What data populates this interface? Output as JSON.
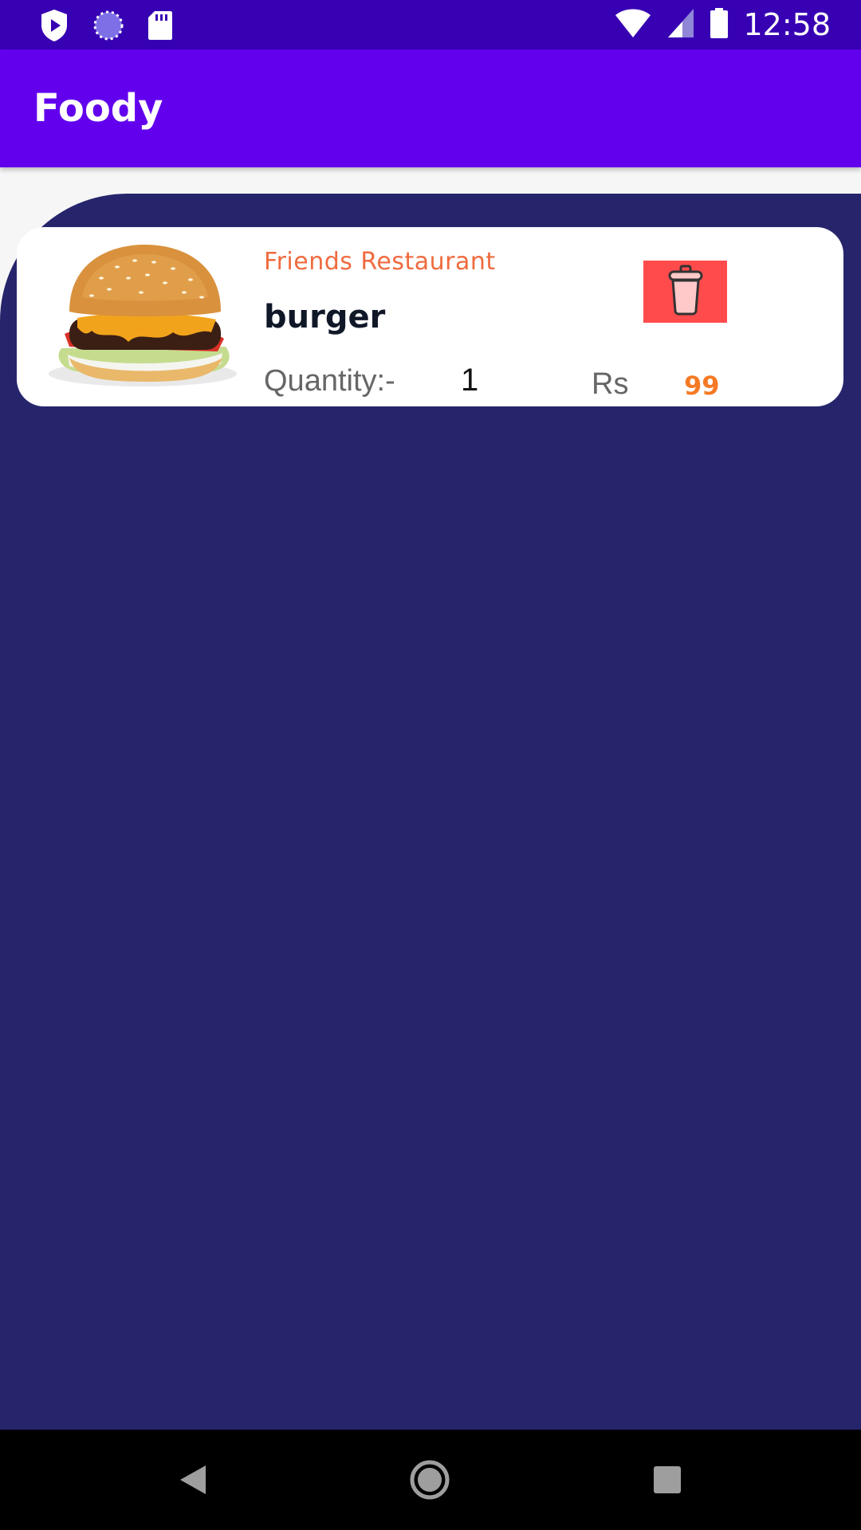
{
  "status_bar": {
    "time": "12:58",
    "icons": [
      "play-protect-icon",
      "sync-progress-icon",
      "sd-card-icon",
      "wifi-icon",
      "signal-icon",
      "battery-icon"
    ]
  },
  "app_bar": {
    "title": "Foody"
  },
  "cart": {
    "items": [
      {
        "image": "burger-image",
        "restaurant": "Friends Restaurant",
        "name": "burger",
        "quantity_label": "Quantity:-",
        "quantity": "1",
        "currency_label": "Rs",
        "price": "99",
        "delete_icon": "trash-icon"
      }
    ]
  },
  "nav_bar": {
    "icons": [
      "back-icon",
      "home-icon",
      "recents-icon"
    ]
  },
  "colors": {
    "status_bar": "#3700b3",
    "app_bar": "#6200ee",
    "content_background": "#26256c",
    "restaurant_text": "#ef6b3e",
    "price_text": "#f57a24",
    "delete_button": "#ff4b4b"
  }
}
